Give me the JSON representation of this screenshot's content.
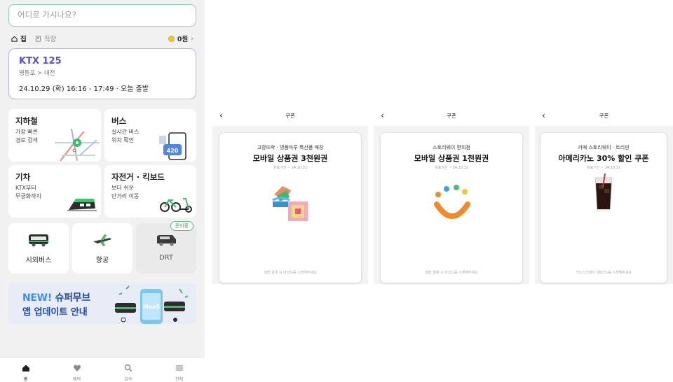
{
  "search": {
    "placeholder": "어디로 가시나요?"
  },
  "quick": {
    "home": "집",
    "work": "직장",
    "points": "0원"
  },
  "ticket": {
    "train": "KTX 125",
    "route": "영등포 > 대전",
    "datetime": "24.10.29 (화) 16:16 - 17:49 · 오늘 출발"
  },
  "services": {
    "subway": {
      "title": "지하철",
      "line1": "가장 빠른",
      "line2": "경로 검색"
    },
    "bus": {
      "title": "버스",
      "line1": "실시간 버스",
      "line2": "위치 확인",
      "bus_number": "420"
    },
    "train": {
      "title": "기차",
      "line1": "KTX부터",
      "line2": "무궁화까지"
    },
    "bike": {
      "title": "자전거 · 킥보드",
      "line1": "보다 쉬운",
      "line2": "단거리 이동"
    }
  },
  "small_services": [
    {
      "label": "시외버스"
    },
    {
      "label": "항공"
    },
    {
      "label": "DRT",
      "badge": "준비중"
    }
  ],
  "banner": {
    "new": "NEW!",
    "title_rest": " 슈퍼무브",
    "line2": "앱 업데이트 안내",
    "phone_text": "MaaS"
  },
  "tabbar": [
    {
      "label": "홈",
      "icon": "home-icon"
    },
    {
      "label": "혜택",
      "icon": "heart-icon"
    },
    {
      "label": "검색",
      "icon": "search-icon"
    },
    {
      "label": "전체",
      "icon": "menu-icon"
    }
  ],
  "coupons": [
    {
      "header": "쿠폰",
      "store": "고향뜨락 · 명품마루 특산품 매장",
      "name": "모바일 상품권 3천원권",
      "valid": "유효기간 ~ 24.10.31",
      "note": "매장 결제 시 바코드를 스캔해주세요"
    },
    {
      "header": "쿠폰",
      "store": "스토리웨이 편의점",
      "name": "모바일 상품권 1천원권",
      "valid": "유효기간 ~ 24.10.31",
      "note": "매장 결제 시 바코드를 스캔해주세요"
    },
    {
      "header": "쿠폰",
      "store": "카페 스토리웨이 · 트리핀",
      "name": "아메리카노 30% 할인 쿠폰",
      "valid": "유효기간 ~ 24.10.31",
      "note": "키오스크에서 QR코드를 스캔해주세요"
    }
  ],
  "colors": {
    "accent_green": "#33a35b",
    "ticket_purple": "#5a4fc7",
    "banner_blue": "#244aa8"
  }
}
